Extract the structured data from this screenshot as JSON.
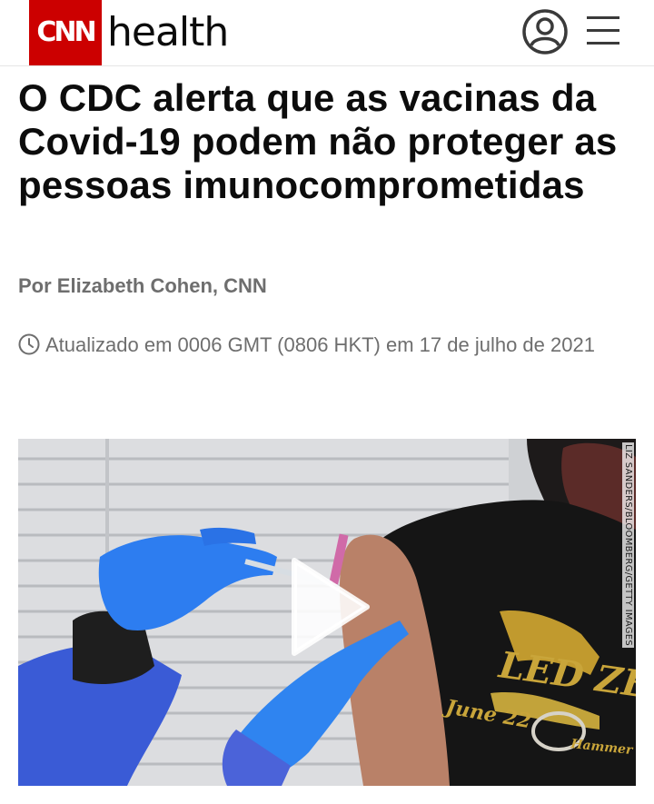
{
  "header": {
    "logo_text": "CNN",
    "section_name": "health",
    "account_icon": "user-circle-icon",
    "menu_icon": "hamburger-menu-icon",
    "brand_color": "#cc0000"
  },
  "article": {
    "headline": "O CDC alerta que as vacinas da Covid-19 podem não proteger as pessoas imunocomprometidas",
    "byline": "Por Elizabeth Cohen, CNN",
    "timestamp_icon": "clock-icon",
    "timestamp": "Atualizado em 0006 GMT (0806 HKT) em 17 de julho de 2021"
  },
  "media": {
    "play_icon": "play-icon",
    "photo_credit": "LIZ SANDERS/BLOOMBERG/GETTY IMAGES",
    "shirt_text_band": "LED ZEPPELIN",
    "shirt_text_date": "June 22",
    "shirt_text_bottom": "Hammer"
  }
}
